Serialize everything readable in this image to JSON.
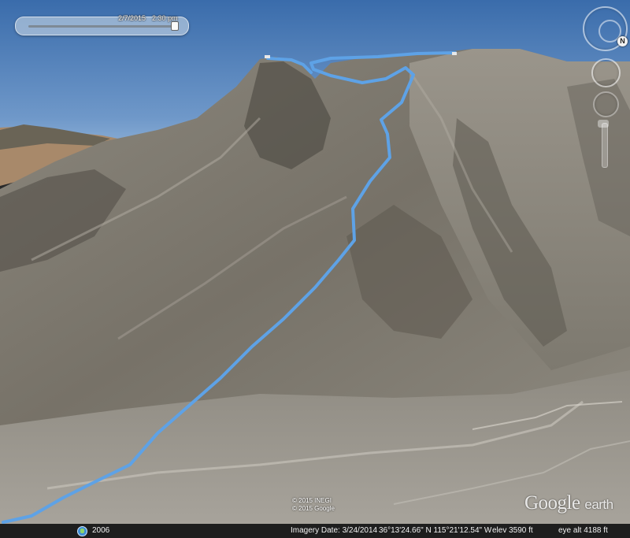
{
  "time_slider": {
    "date": "2/7/2015",
    "time": "2:30 pm"
  },
  "nav_controls": {
    "north_label": "N"
  },
  "attribution": {
    "line1": "© 2015 INEGI",
    "line2": "© 2015 Google"
  },
  "logo": {
    "google": "Google",
    "earth": "earth"
  },
  "status_bar": {
    "historical_year": "2006",
    "imagery_date": "Imagery Date: 3/24/2014",
    "coordinates": "36°13'24.66\" N  115°21'12.54\" W",
    "elevation": "elev  3590 ft",
    "eye_altitude": "eye alt  4188 ft"
  },
  "colors": {
    "sky_top": "#3f72b0",
    "sky_horizon": "#9fbfdc",
    "mountain": "#8a857b",
    "route": "#5ea2e6"
  }
}
